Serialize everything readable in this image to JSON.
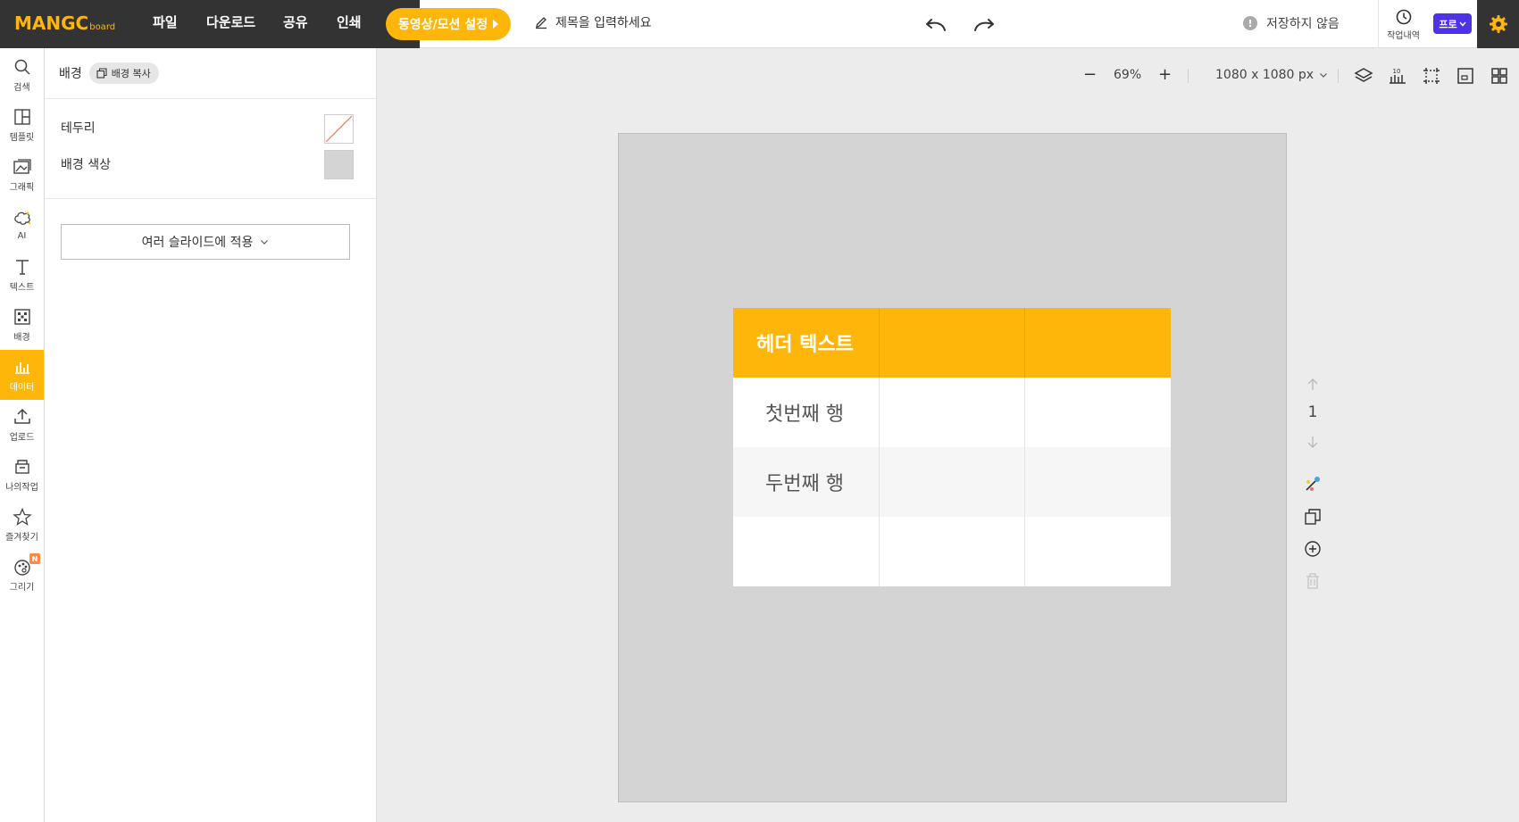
{
  "app": {
    "logo_main": "MANGC",
    "logo_sub": "board",
    "brand_color": "#ffb60b"
  },
  "topbar": {
    "menu": [
      "파일",
      "다운로드",
      "공유",
      "인쇄"
    ],
    "motion_button": "동영상/모션 설정",
    "title_placeholder": "제목을 입력하세요",
    "save_status": "저장하지 않음",
    "history_label": "작업내역",
    "pro_label": "프로"
  },
  "rail": {
    "items": [
      {
        "label": "검색",
        "icon": "search-icon"
      },
      {
        "label": "템플릿",
        "icon": "template-icon"
      },
      {
        "label": "그래픽",
        "icon": "graphic-icon"
      },
      {
        "label": "AI",
        "icon": "ai-icon"
      },
      {
        "label": "텍스트",
        "icon": "text-icon"
      },
      {
        "label": "배경",
        "icon": "background-icon"
      },
      {
        "label": "데이터",
        "icon": "chart-icon",
        "active": true
      },
      {
        "label": "업로드",
        "icon": "upload-icon"
      },
      {
        "label": "나의작업",
        "icon": "my-work-icon"
      },
      {
        "label": "즐겨찾기",
        "icon": "star-icon"
      },
      {
        "label": "그리기",
        "icon": "draw-icon",
        "badge": "N"
      }
    ]
  },
  "panel": {
    "title": "배경",
    "copy_chip": "배경 복사",
    "border_label": "테두리",
    "bg_color_label": "배경 색상",
    "bg_color": "#d4d4d4",
    "apply_button": "여러 슬라이드에 적용"
  },
  "toolbar": {
    "zoom_minus": "−",
    "zoom_value": "69%",
    "zoom_plus": "+",
    "canvas_size": "1080 x 1080 px"
  },
  "canvas": {
    "page_number": "1",
    "table": {
      "header_color": "#ffb60b",
      "rows": [
        [
          "헤더 텍스트",
          "",
          ""
        ],
        [
          "첫번째 행",
          "",
          ""
        ],
        [
          "두번째 행",
          "",
          ""
        ],
        [
          "",
          "",
          ""
        ]
      ]
    }
  }
}
